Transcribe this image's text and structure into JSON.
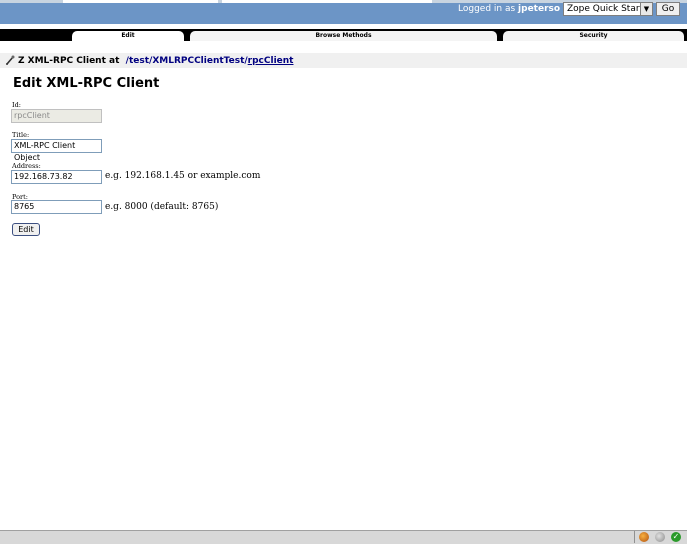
{
  "header": {
    "login_prefix": "Logged in as",
    "username": "jpeterso",
    "quick_start_value": "Zope Quick Start",
    "go_label": "Go"
  },
  "tabs": [
    {
      "label": "Edit",
      "active": true
    },
    {
      "label": "Browse Methods",
      "active": false
    },
    {
      "label": "Security",
      "active": false
    }
  ],
  "breadcrumb": {
    "prefix": "Z XML-RPC Client at",
    "path_parts": [
      "/test",
      "/XMLRPCClientTest",
      "/",
      "rpcClient"
    ]
  },
  "page": {
    "title": "Edit XML-RPC Client"
  },
  "form": {
    "id_label": "Id",
    "id_value": "rpcClient",
    "title_label": "Title",
    "title_value": "XML-RPC Client Object",
    "address_label": "Address",
    "address_value": "192.168.73.82",
    "address_hint": "e.g. 192.168.1.45 or example.com",
    "port_label": "Port",
    "port_value": "8765",
    "port_hint": "e.g. 8000 (default: 8765)",
    "submit_label": "Edit"
  },
  "colors": {
    "topbar": "#6c95c6",
    "link": "#000080",
    "tabbar": "#000000"
  }
}
